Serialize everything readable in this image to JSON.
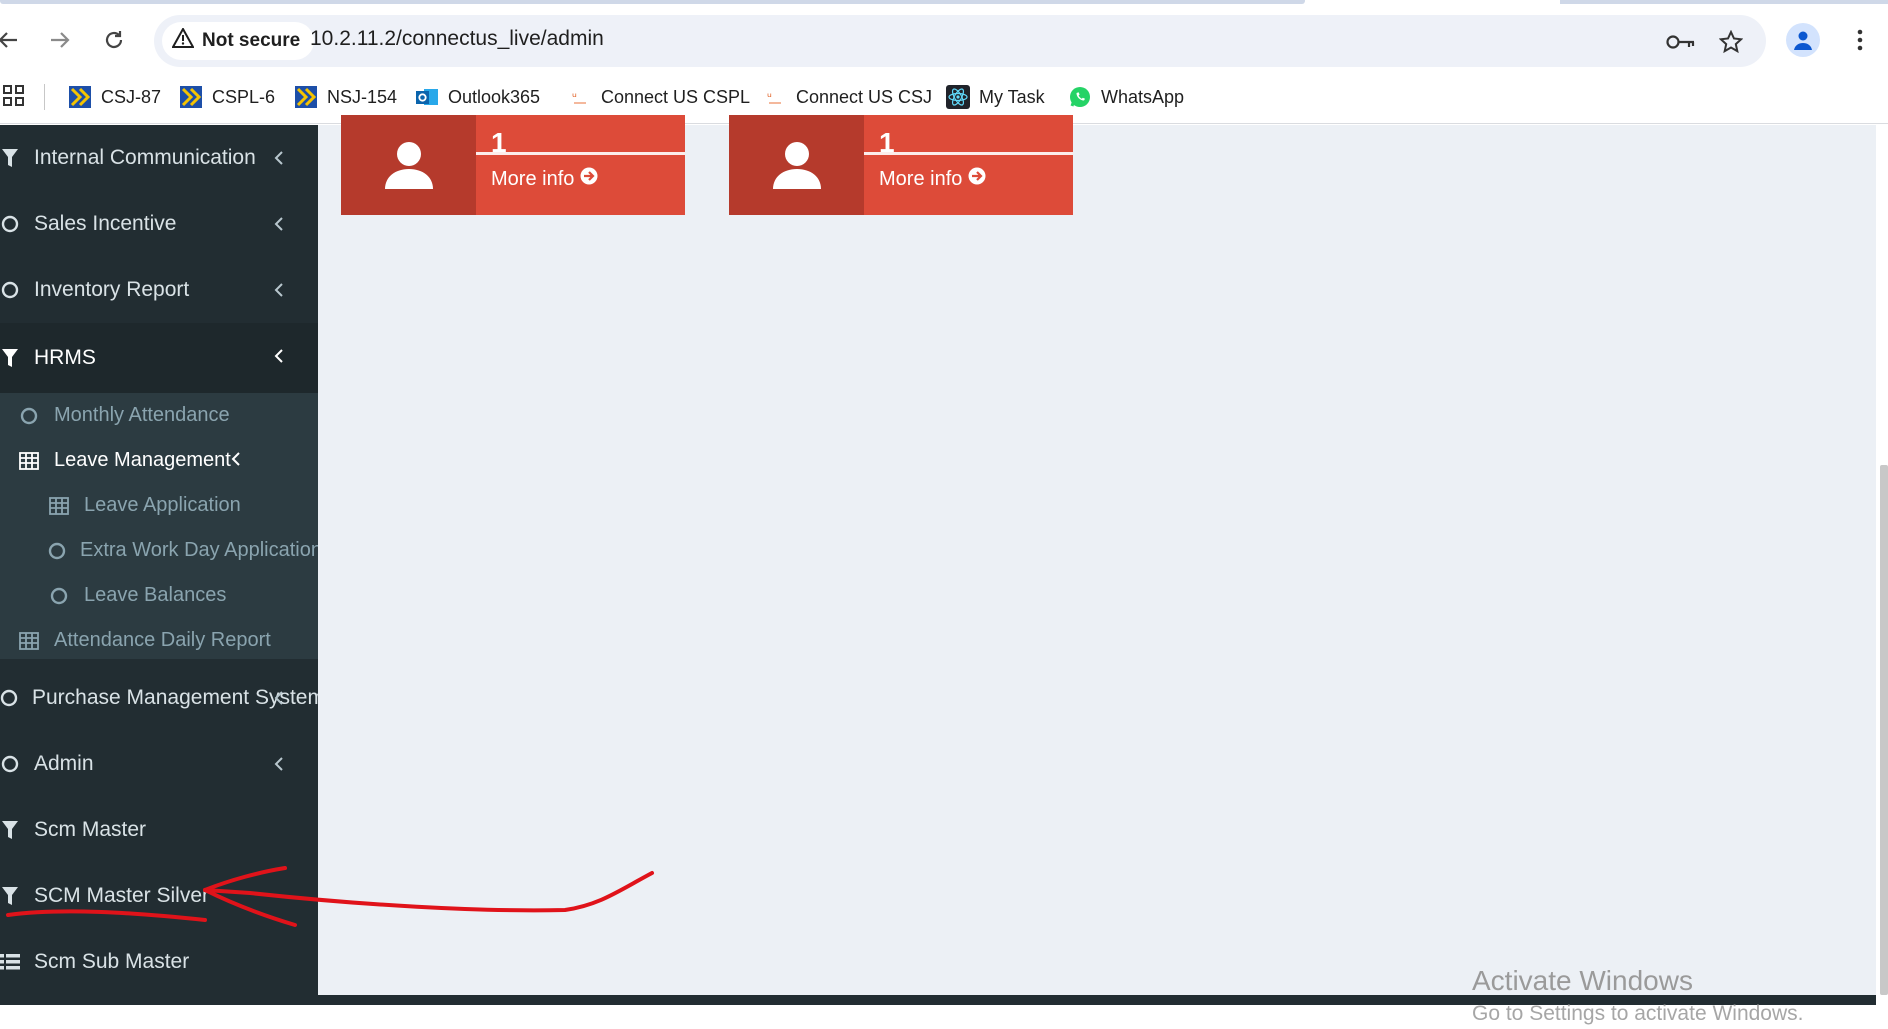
{
  "browser": {
    "security_label": "Not secure",
    "url": "10.2.11.2/connectus_live/admin",
    "bookmarks": [
      {
        "label": "CSJ-87"
      },
      {
        "label": "CSPL-6"
      },
      {
        "label": "NSJ-154"
      },
      {
        "label": "Outlook365"
      },
      {
        "label": "Connect US CSPL"
      },
      {
        "label": "Connect US CSJ"
      },
      {
        "label": "My Task"
      },
      {
        "label": "WhatsApp"
      }
    ]
  },
  "sidebar": {
    "items": [
      {
        "label": "Internal Communication",
        "icon": "filter-icon"
      },
      {
        "label": "Sales Incentive",
        "icon": "circle-icon"
      },
      {
        "label": "Inventory Report",
        "icon": "circle-icon"
      },
      {
        "label": "HRMS",
        "icon": "filter-icon"
      },
      {
        "label": "Purchase Management System",
        "icon": "circle-icon"
      },
      {
        "label": "Admin",
        "icon": "circle-icon"
      },
      {
        "label": "Scm Master",
        "icon": "filter-icon"
      },
      {
        "label": "SCM Master Silver",
        "icon": "filter-icon"
      },
      {
        "label": "Scm Sub Master",
        "icon": "list-icon"
      }
    ],
    "hrms_sub": [
      {
        "label": "Monthly Attendance",
        "icon": "circle-icon"
      },
      {
        "label": "Leave Management",
        "icon": "table-icon"
      },
      {
        "label": "Leave Application",
        "icon": "table-icon"
      },
      {
        "label": "Extra Work Day Application",
        "icon": "circle-icon"
      },
      {
        "label": "Leave Balances",
        "icon": "circle-icon"
      },
      {
        "label": "Attendance Daily Report",
        "icon": "table-icon"
      }
    ]
  },
  "boxes": [
    {
      "number": "1",
      "more": "More info"
    },
    {
      "number": "1",
      "more": "More info"
    }
  ],
  "watermark": {
    "title": "Activate Windows",
    "subtitle": "Go to Settings to activate Windows."
  },
  "colors": {
    "sidebar_bg": "#222d32",
    "submenu_bg": "#2c3b41",
    "content_bg": "#ecf0f5",
    "box_red": "#dd4b39",
    "box_dark": "#b53a2c",
    "annotation_red": "#e0131a"
  }
}
